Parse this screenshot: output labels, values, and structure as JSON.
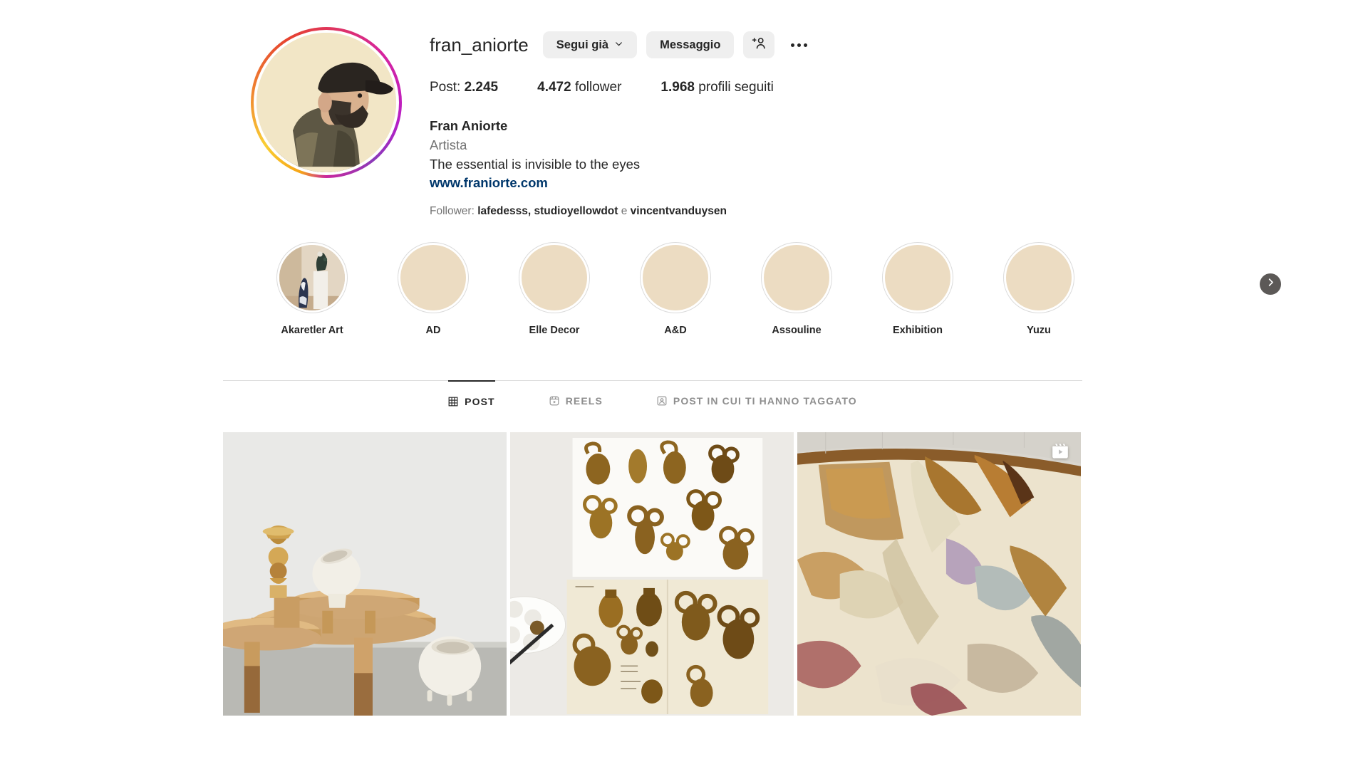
{
  "profile": {
    "username": "fran_aniorte",
    "avatar_icon": "profile-avatar",
    "buttons": {
      "follow_label": "Segui già",
      "chevron_icon": "chevron-down-icon",
      "message_label": "Messaggio",
      "add_person_icon": "add-person-icon",
      "options_icon": "more-options-icon"
    },
    "stats": [
      {
        "label_before": "Post: ",
        "value": "2.245",
        "label_after": ""
      },
      {
        "label_before": "",
        "value": "4.472",
        "label_after": " follower"
      },
      {
        "label_before": "",
        "value": "1.968",
        "label_after": " profili seguiti"
      }
    ],
    "bio": {
      "full_name": "Fran Aniorte",
      "category": "Artista",
      "description": "The essential is invisible to the eyes",
      "link": "www.franiorte.com"
    },
    "mutuals": {
      "prefix": "Follower: ",
      "names": "lafedesss, studioyellowdot",
      "conjunction": " e ",
      "last_name": "vincentvanduysen"
    }
  },
  "highlights": {
    "next_icon": "chevron-right-icon",
    "items": [
      {
        "label": "Akaretler Art",
        "has_cover": true
      },
      {
        "label": "AD",
        "has_cover": false
      },
      {
        "label": "Elle Decor",
        "has_cover": false
      },
      {
        "label": "A&D",
        "has_cover": false
      },
      {
        "label": "Assouline",
        "has_cover": false
      },
      {
        "label": "Exhibition",
        "has_cover": false
      },
      {
        "label": "Yuzu",
        "has_cover": false
      }
    ]
  },
  "tabs": [
    {
      "label": "POST",
      "icon": "grid-icon",
      "active": true
    },
    {
      "label": "REELS",
      "icon": "reels-icon",
      "active": false
    },
    {
      "label": "POST IN CUI TI HANNO TAGGATO",
      "icon": "tagged-icon",
      "active": false
    }
  ],
  "posts": [
    {
      "alt": "wooden-tables-white-ceramic-vessels",
      "badge": ""
    },
    {
      "alt": "sketchbook-brown-ink-vessel-drawings",
      "badge": ""
    },
    {
      "alt": "glazed-ceramic-bowl-interior",
      "badge": "reels-badge-icon"
    }
  ],
  "colors": {
    "text_primary": "#262626",
    "text_secondary": "#737373",
    "link": "#00376b",
    "button_bg": "#efefef",
    "divider": "#dbdbdb",
    "highlight_cover": "#ecdcc2"
  }
}
